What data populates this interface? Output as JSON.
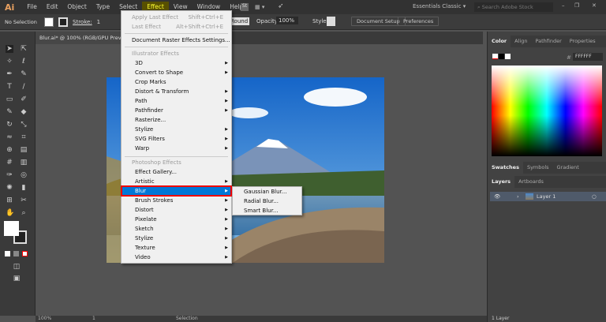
{
  "app": {
    "logo": "Ai",
    "workspace": "Essentials Classic",
    "search_placeholder": "Search Adobe Stock"
  },
  "menubar": [
    "File",
    "Edit",
    "Object",
    "Type",
    "Select",
    "Effect",
    "View",
    "Window",
    "Help"
  ],
  "control": {
    "selection": "No Selection",
    "stroke_label": "Stroke:",
    "stroke_value": "1",
    "round": "Round",
    "opacity_label": "Opacity:",
    "opacity": "100%",
    "style_label": "Style:",
    "doc_setup": "Document Setup",
    "preferences": "Preferences"
  },
  "document": {
    "tab": "Blur.ai* @ 100% (RGB/GPU Preview)"
  },
  "effect_menu": {
    "apply_last": {
      "label": "Apply Last Effect",
      "shortcut": "Shift+Ctrl+E"
    },
    "last": {
      "label": "Last Effect",
      "shortcut": "Alt+Shift+Ctrl+E"
    },
    "raster_settings": "Document Raster Effects Settings...",
    "illustrator_header": "Illustrator Effects",
    "illustrator_items": [
      {
        "label": "3D",
        "sub": true
      },
      {
        "label": "Convert to Shape",
        "sub": true
      },
      {
        "label": "Crop Marks",
        "sub": false
      },
      {
        "label": "Distort & Transform",
        "sub": true
      },
      {
        "label": "Path",
        "sub": true
      },
      {
        "label": "Pathfinder",
        "sub": true
      },
      {
        "label": "Rasterize...",
        "sub": false
      },
      {
        "label": "Stylize",
        "sub": true
      },
      {
        "label": "SVG Filters",
        "sub": true
      },
      {
        "label": "Warp",
        "sub": true
      }
    ],
    "photoshop_header": "Photoshop Effects",
    "photoshop_items": [
      {
        "label": "Effect Gallery...",
        "sub": false
      },
      {
        "label": "Artistic",
        "sub": true
      },
      {
        "label": "Blur",
        "sub": true,
        "highlighted": true
      },
      {
        "label": "Brush Strokes",
        "sub": true
      },
      {
        "label": "Distort",
        "sub": true
      },
      {
        "label": "Pixelate",
        "sub": true
      },
      {
        "label": "Sketch",
        "sub": true
      },
      {
        "label": "Stylize",
        "sub": true
      },
      {
        "label": "Texture",
        "sub": true
      },
      {
        "label": "Video",
        "sub": true
      }
    ]
  },
  "blur_submenu": [
    "Gaussian Blur...",
    "Radial Blur...",
    "Smart Blur..."
  ],
  "panels": {
    "color_tabs": [
      "Color",
      "Align",
      "Pathfinder",
      "Properties"
    ],
    "hex_label": "#",
    "hex": "FFFFFF",
    "swatch_tabs": [
      "Swatches",
      "Symbols",
      "Gradient"
    ],
    "layer_tabs": [
      "Layers",
      "Artboards"
    ],
    "layers": [
      {
        "name": "Layer 1"
      }
    ],
    "layers_count": "1 Layer"
  },
  "status": {
    "zoom": "100%",
    "artboard": "1",
    "tool": "Selection"
  },
  "colors": {
    "highlight": "#0078d7",
    "highlight_outline": "#e00000",
    "menu_bg": "#f0f0f0",
    "ui_dark": "#323232",
    "canvas": "#535353"
  }
}
